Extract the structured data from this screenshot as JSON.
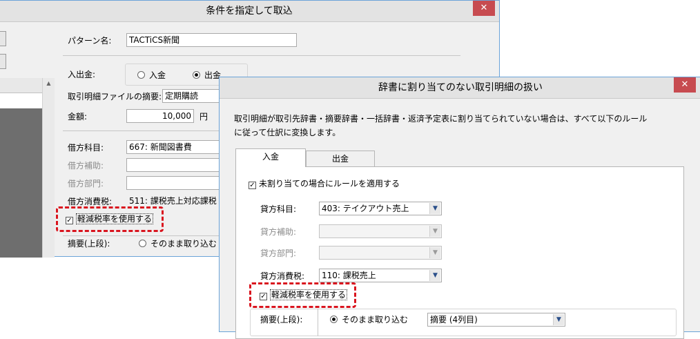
{
  "win1": {
    "title": "条件を指定して取込",
    "close_glyph": "✕",
    "pattern_label": "パターン名:",
    "pattern_value": "TACTiCS新聞",
    "nyushukkin_label": "入出金:",
    "radio_nyukin": "入金",
    "radio_shukkin": "出金",
    "tekiyo_label": "取引明細ファイルの摘要:",
    "tekiyo_value": "定期購読",
    "kingaku_label": "金額:",
    "kingaku_value": "10,000",
    "kingaku_unit": "円",
    "karikata_label": "借方科目:",
    "karikata_value": "667: 新聞図書費",
    "karikata_hojo_label": "借方補助:",
    "karikata_bumon_label": "借方部門:",
    "karikata_tax_label": "借方消費税:",
    "karikata_tax_value": "511: 課税売上対応課税",
    "reduced_tax_label": "軽減税率を使用する",
    "tekiyo_upper_label": "摘要(上段):",
    "sonomama_label": "そのまま取り込む"
  },
  "win2": {
    "title": "辞書に割り当てのない取引明細の扱い",
    "close_glyph": "✕",
    "desc_line1": "取引明細が取引先辞書・摘要辞書・一括辞書・返済予定表に割り当てられていない場合は、すべて以下のルール",
    "desc_line2": "に従って仕訳に変換します。",
    "tab_nyukin": "入金",
    "tab_shukkin": "出金",
    "apply_rule_label": "未割り当ての場合にルールを適用する",
    "kashikata_label": "貸方科目:",
    "kashikata_value": "403: テイクアウト売上",
    "kashikata_hojo_label": "貸方補助:",
    "kashikata_bumon_label": "貸方部門:",
    "kashikata_tax_label": "貸方消費税:",
    "kashikata_tax_value": "110: 課税売上",
    "reduced_tax_label": "軽減税率を使用する",
    "tekiyo_upper_label": "摘要(上段):",
    "sonomama_label": "そのまま取り込む",
    "tekiyo_col_value": "摘要 (4列目)"
  },
  "glyphs": {
    "check": "✓",
    "combo_arrow": "▼",
    "scroll_up": "▲"
  }
}
